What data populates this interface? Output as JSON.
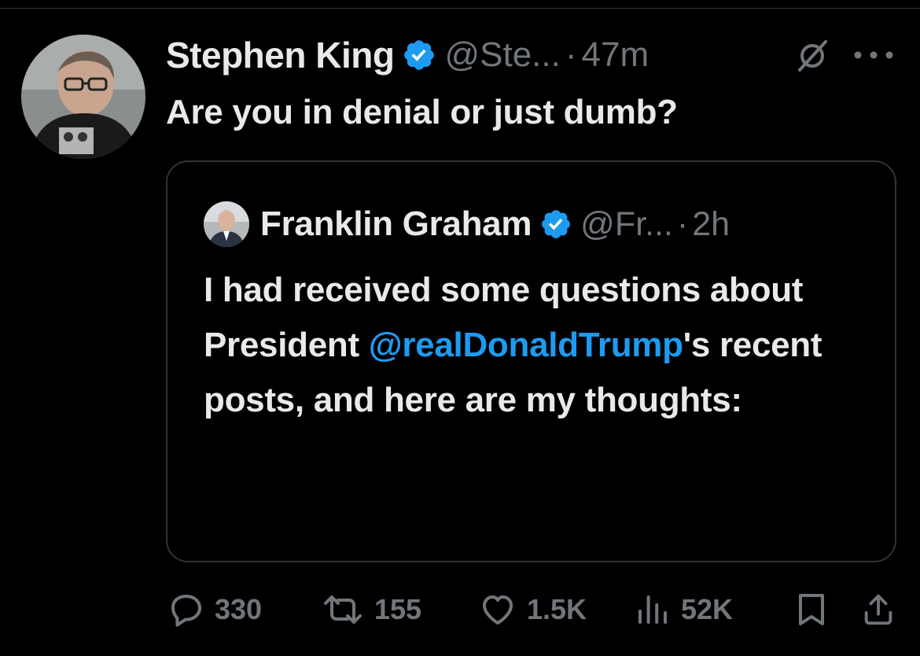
{
  "post": {
    "author": {
      "display_name": "Stephen King",
      "handle": "@Ste...",
      "separator": "·",
      "time": "47m",
      "avatar_icon": "person-photo-avatar",
      "verified_icon": "verified-badge-icon"
    },
    "text": "Are you in denial or just dumb?",
    "header_icons": [
      "grok-icon",
      "more-icon"
    ]
  },
  "quote": {
    "author": {
      "display_name": "Franklin Graham",
      "handle": "@Fr...",
      "separator": "·",
      "time": "2h",
      "avatar_icon": "person-photo-avatar",
      "verified_icon": "verified-badge-icon"
    },
    "text_before": "I had received some questions about President ",
    "mention": "@realDonaldTrump",
    "text_after": "'s recent posts, and here are my thoughts:"
  },
  "actions": {
    "reply": {
      "icon": "reply-icon",
      "count": "330"
    },
    "repost": {
      "icon": "repost-icon",
      "count": "155"
    },
    "like": {
      "icon": "heart-icon",
      "count": "1.5K"
    },
    "views": {
      "icon": "views-icon",
      "count": "52K"
    },
    "bookmark": {
      "icon": "bookmark-icon"
    },
    "share": {
      "icon": "share-icon"
    }
  },
  "colors": {
    "background": "#000000",
    "text_primary": "#e7e9ea",
    "text_secondary": "#71767b",
    "accent": "#1d9bf0",
    "border": "#2f3336"
  }
}
